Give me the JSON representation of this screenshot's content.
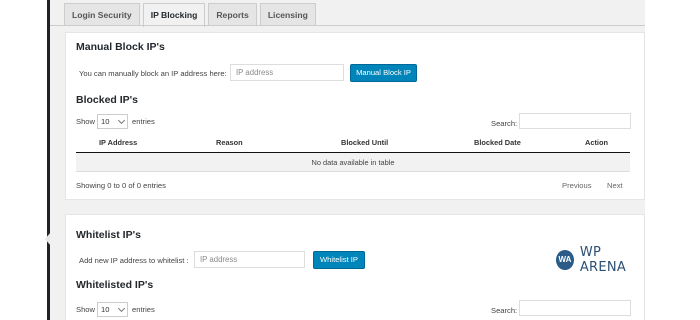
{
  "tabs": [
    "Login Security",
    "IP Blocking",
    "Reports",
    "Licensing"
  ],
  "active_tab": "IP Blocking",
  "manual_block": {
    "title": "Manual Block IP's",
    "label": "You can manually block an IP address here:",
    "placeholder": "IP address",
    "button": "Manual Block IP"
  },
  "blocked": {
    "title": "Blocked IP's",
    "show": "Show",
    "entries_value": "10",
    "entries": "entries",
    "search": "Search:",
    "columns": [
      "IP Address",
      "Reason",
      "Blocked Until",
      "Blocked Date",
      "Action"
    ],
    "empty": "No data available in table",
    "info": "Showing 0 to 0 of 0 entries",
    "previous": "Previous",
    "next": "Next"
  },
  "whitelist": {
    "title": "Whitelist IP's",
    "label": "Add new IP address to whitelist :",
    "placeholder": "IP address",
    "button": "Whitelist IP",
    "list_title": "Whitelisted IP's",
    "show": "Show",
    "entries_value": "10",
    "entries": "entries",
    "search": "Search:"
  },
  "watermark": {
    "monogram": "WA",
    "text": "WP ARENA"
  },
  "colors": {
    "primary_button": "#0085ba",
    "admin_bar": "#1f2327",
    "logo": "#2b5c88"
  }
}
